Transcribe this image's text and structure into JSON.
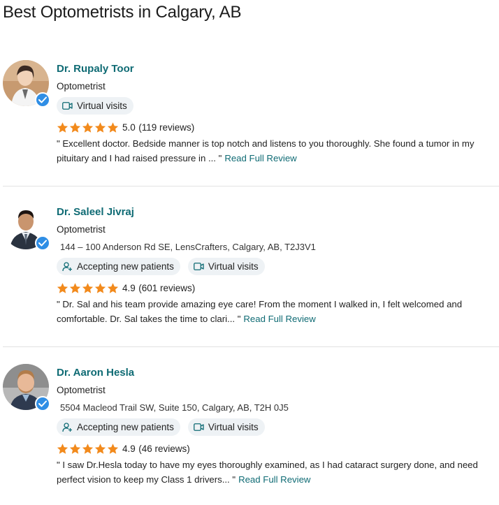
{
  "page": {
    "title": "Best Optometrists in Calgary, AB"
  },
  "colors": {
    "accent": "#0f6b74",
    "star": "#f28a1c",
    "verified": "#2f8ee5",
    "pill_bg": "#eef2f5"
  },
  "doctors": [
    {
      "name": "Dr. Rupaly Toor",
      "specialty": "Optometrist",
      "address": "",
      "pills": {
        "accepting": "",
        "virtual": "Virtual visits"
      },
      "rating": "5.0",
      "reviews": "(119 reviews)",
      "review_text": "\" Excellent doctor. Bedside manner is top notch and listens to you thoroughly. She found a tumor in my pituitary and I had raised pressure in ... \"",
      "read_more": "Read Full Review",
      "stars": 5.0
    },
    {
      "name": "Dr. Saleel Jivraj",
      "specialty": "Optometrist",
      "address": "144 – 100 Anderson Rd SE, LensCrafters, Calgary, AB, T2J3V1",
      "pills": {
        "accepting": "Accepting new patients",
        "virtual": "Virtual visits"
      },
      "rating": "4.9",
      "reviews": "(601 reviews)",
      "review_text": "\" Dr. Sal and his team provide amazing eye care! From the moment I walked in, I felt welcomed and comfortable. Dr. Sal takes the time to clari... \"",
      "read_more": "Read Full Review",
      "stars": 4.9
    },
    {
      "name": "Dr. Aaron Hesla",
      "specialty": "Optometrist",
      "address": "5504 Macleod Trail SW, Suite 150, Calgary, AB, T2H 0J5",
      "pills": {
        "accepting": "Accepting new patients",
        "virtual": "Virtual visits"
      },
      "rating": "4.9",
      "reviews": "(46 reviews)",
      "review_text": "\" I saw Dr.Hesla today to have my eyes thoroughly examined, as I had cataract surgery done, and need perfect vision to keep my Class 1 drivers... \"",
      "read_more": "Read Full Review",
      "stars": 4.9
    }
  ]
}
